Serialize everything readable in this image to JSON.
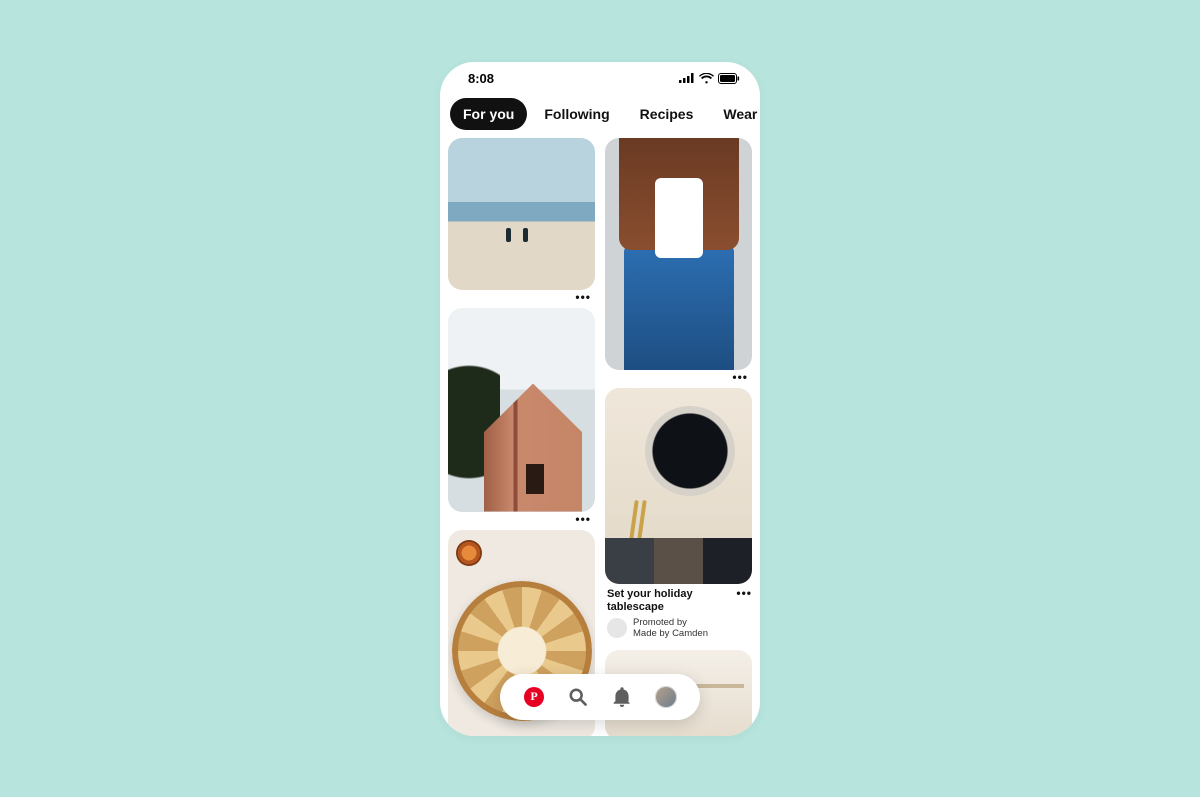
{
  "status": {
    "time": "8:08"
  },
  "tabs": [
    {
      "label": "For you",
      "active": true
    },
    {
      "label": "Following",
      "active": false
    },
    {
      "label": "Recipes",
      "active": false
    },
    {
      "label": "Wear",
      "active": false
    }
  ],
  "promo": {
    "title": "Set your holiday tablescape",
    "line1": "Promoted by",
    "line2": "Made by Camden"
  },
  "icons": {
    "more": "•••"
  }
}
